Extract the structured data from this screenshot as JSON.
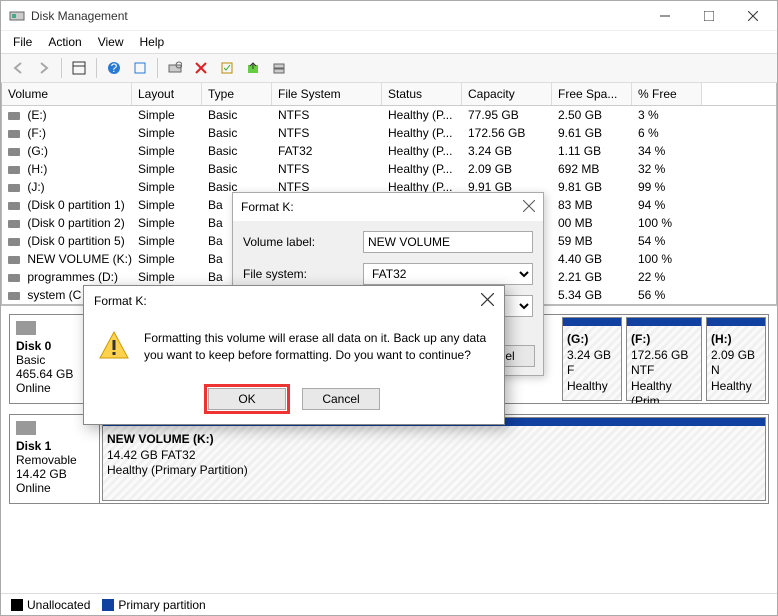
{
  "window": {
    "title": "Disk Management"
  },
  "menu": {
    "file": "File",
    "action": "Action",
    "view": "View",
    "help": "Help"
  },
  "columns": {
    "volume": "Volume",
    "layout": "Layout",
    "type": "Type",
    "fs": "File System",
    "status": "Status",
    "capacity": "Capacity",
    "free": "Free Spa...",
    "pfree": "% Free"
  },
  "rows": [
    {
      "v": " (E:)",
      "l": "Simple",
      "t": "Basic",
      "f": "NTFS",
      "s": "Healthy (P...",
      "c": "77.95 GB",
      "fr": "2.50 GB",
      "p": "3 %"
    },
    {
      "v": " (F:)",
      "l": "Simple",
      "t": "Basic",
      "f": "NTFS",
      "s": "Healthy (P...",
      "c": "172.56 GB",
      "fr": "9.61 GB",
      "p": "6 %"
    },
    {
      "v": " (G:)",
      "l": "Simple",
      "t": "Basic",
      "f": "FAT32",
      "s": "Healthy (P...",
      "c": "3.24 GB",
      "fr": "1.11 GB",
      "p": "34 %"
    },
    {
      "v": " (H:)",
      "l": "Simple",
      "t": "Basic",
      "f": "NTFS",
      "s": "Healthy (P...",
      "c": "2.09 GB",
      "fr": "692 MB",
      "p": "32 %"
    },
    {
      "v": " (J:)",
      "l": "Simple",
      "t": "Basic",
      "f": "NTFS",
      "s": "Healthy (P...",
      "c": "9.91 GB",
      "fr": "9.81 GB",
      "p": "99 %"
    },
    {
      "v": " (Disk 0 partition 1)",
      "l": "Simple",
      "t": "Ba",
      "f": "",
      "s": "",
      "c": "",
      "fr": "83 MB",
      "p": "94 %"
    },
    {
      "v": " (Disk 0 partition 2)",
      "l": "Simple",
      "t": "Ba",
      "f": "",
      "s": "",
      "c": "",
      "fr": "00 MB",
      "p": "100 %"
    },
    {
      "v": " (Disk 0 partition 5)",
      "l": "Simple",
      "t": "Ba",
      "f": "",
      "s": "",
      "c": "",
      "fr": "59 MB",
      "p": "54 %"
    },
    {
      "v": " NEW VOLUME (K:)",
      "l": "Simple",
      "t": "Ba",
      "f": "",
      "s": "",
      "c": "",
      "fr": "4.40 GB",
      "p": "100 %"
    },
    {
      "v": " programmes (D:)",
      "l": "Simple",
      "t": "Ba",
      "f": "",
      "s": "",
      "c": "",
      "fr": "2.21 GB",
      "p": "22 %"
    },
    {
      "v": " system (C",
      "l": "",
      "t": "",
      "f": "",
      "s": "",
      "c": "",
      "fr": "5.34 GB",
      "p": "56 %"
    }
  ],
  "disk0": {
    "name": "Disk 0",
    "type": "Basic",
    "size": "465.64 GB",
    "status": "Online",
    "parts": [
      {
        "n": "(G:)",
        "s": "3.24 GB F",
        "st": "Healthy"
      },
      {
        "n": "(F:)",
        "s": "172.56 GB NTF",
        "st": "Healthy (Prim"
      },
      {
        "n": "(H:)",
        "s": "2.09 GB N",
        "st": "Healthy"
      }
    ]
  },
  "disk1": {
    "name": "Disk 1",
    "type": "Removable",
    "size": "14.42 GB",
    "status": "Online",
    "part": {
      "n": "NEW VOLUME  (K:)",
      "s": "14.42 GB FAT32",
      "st": "Healthy (Primary Partition)"
    }
  },
  "legend": {
    "u": "Unallocated",
    "p": "Primary partition"
  },
  "dlg1": {
    "title": "Format K:",
    "vol_label_lbl": "Volume label:",
    "vol_label_val": "NEW VOLUME",
    "fs_lbl": "File system:",
    "fs_val": "FAT32",
    "cancel": "Cancel"
  },
  "dlg2": {
    "title": "Format K:",
    "msg": "Formatting this volume will erase all data on it. Back up any data you want to keep before formatting. Do you want to continue?",
    "ok": "OK",
    "cancel": "Cancel"
  }
}
